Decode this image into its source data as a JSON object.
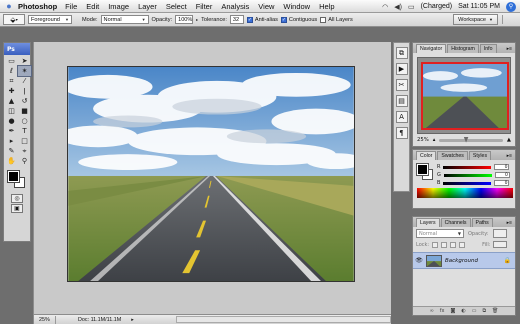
{
  "menubar": {
    "app_name": "Photoshop",
    "items": [
      "File",
      "Edit",
      "Image",
      "Layer",
      "Select",
      "Filter",
      "Analysis",
      "View",
      "Window",
      "Help"
    ],
    "battery": "(Charged)",
    "clock": "Sat 11:05 PM"
  },
  "options": {
    "sample_size": "Foreground",
    "mode_label": "Mode:",
    "mode_value": "Normal",
    "opacity_label": "Opacity:",
    "opacity_value": "100%",
    "tolerance_label": "Tolerance:",
    "tolerance_value": "32",
    "antialias": {
      "label": "Anti-alias",
      "checked": true
    },
    "contiguous": {
      "label": "Contiguous",
      "checked": true
    },
    "all_layers": {
      "label": "All Layers",
      "checked": false
    },
    "workspace": "Workspace"
  },
  "toolbox": {
    "title": "Ps",
    "tools": [
      {
        "name": "marquee-tool",
        "glyph": "▭"
      },
      {
        "name": "move-tool",
        "glyph": "➤"
      },
      {
        "name": "lasso-tool",
        "glyph": "ℓ"
      },
      {
        "name": "magic-wand-tool",
        "glyph": "✶"
      },
      {
        "name": "crop-tool",
        "glyph": "⌗"
      },
      {
        "name": "eyedropper-tool",
        "glyph": "⁄"
      },
      {
        "name": "healing-brush-tool",
        "glyph": "✚"
      },
      {
        "name": "brush-tool",
        "glyph": "ǀ"
      },
      {
        "name": "clone-stamp-tool",
        "glyph": "▲"
      },
      {
        "name": "history-brush-tool",
        "glyph": "↺"
      },
      {
        "name": "eraser-tool",
        "glyph": "◫"
      },
      {
        "name": "gradient-tool",
        "glyph": "■"
      },
      {
        "name": "blur-tool",
        "glyph": "●"
      },
      {
        "name": "dodge-tool",
        "glyph": "○"
      },
      {
        "name": "pen-tool",
        "glyph": "✒"
      },
      {
        "name": "type-tool",
        "glyph": "T"
      },
      {
        "name": "path-selection-tool",
        "glyph": "▸"
      },
      {
        "name": "shape-tool",
        "glyph": "□"
      },
      {
        "name": "notes-tool",
        "glyph": "✎"
      },
      {
        "name": "3d-rotate-tool",
        "glyph": "⌖"
      },
      {
        "name": "hand-tool",
        "glyph": "✋"
      },
      {
        "name": "zoom-tool",
        "glyph": "⚲"
      }
    ],
    "active_index": 3
  },
  "document": {
    "zoom": "25%",
    "doc_info": "Doc: 11.1M/11.1M"
  },
  "navigator": {
    "tabs": [
      "Navigator",
      "Histogram",
      "Info"
    ],
    "zoom": "25%"
  },
  "color": {
    "tabs": [
      "Color",
      "Swatches",
      "Styles"
    ],
    "channels": [
      {
        "label": "R",
        "value": "0"
      },
      {
        "label": "G",
        "value": "0"
      },
      {
        "label": "B",
        "value": "0"
      }
    ]
  },
  "layers": {
    "tabs": [
      "Layers",
      "Channels",
      "Paths"
    ],
    "blend_mode": "Normal",
    "opacity_label": "Opacity:",
    "lock_label": "Lock:",
    "fill_label": "Fill:",
    "layer_name": "Background"
  },
  "colors": {
    "selection_accent": "#3b6fd6",
    "navigator_frame": "#e02020",
    "layer_selected": "#b8c9ea"
  }
}
